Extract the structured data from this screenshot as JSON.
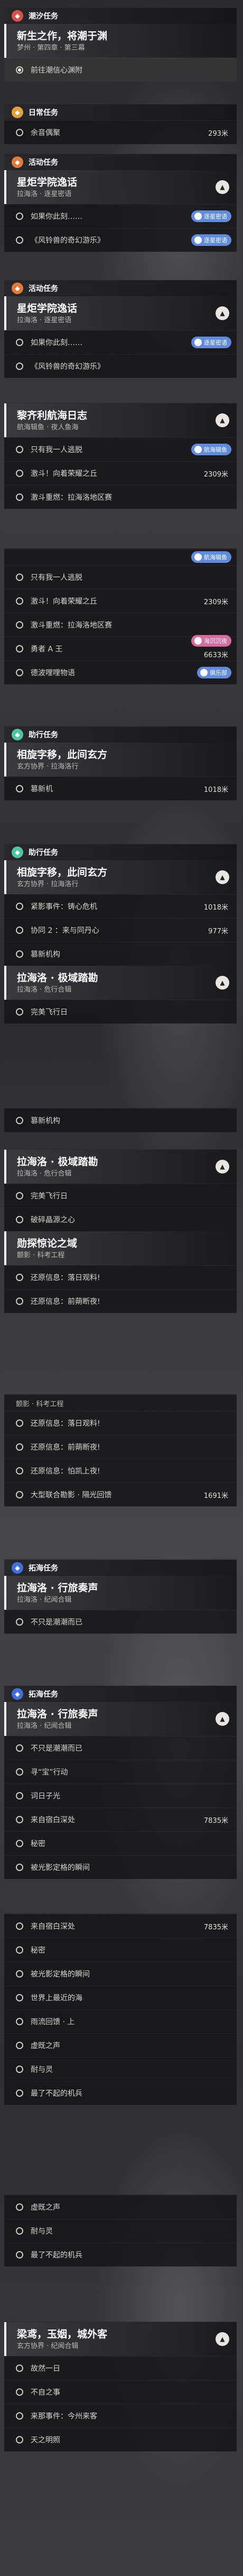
{
  "colors": {
    "main": "#d3534a",
    "daily": "#e2a03a",
    "event": "#e07a3a",
    "companion": "#4fc3a6",
    "ruins": "#3f6fd8",
    "tagBlue": "#5e8be0",
    "tagPink": "#d86ca0"
  },
  "categories": {
    "main": "潮汐任务",
    "daily": "日常任务",
    "event": "活动任务",
    "companion": "助行任务",
    "faction": "拓海任务"
  },
  "main_quest": {
    "title": "新生之作，将潮于渊",
    "sub": "梦州 · 第四章 · 第三幕",
    "step": "前往潮信心渊附"
  },
  "daily": {
    "steps": [
      {
        "text": "余音偶聚",
        "dist": "293米"
      }
    ]
  },
  "event1": {
    "title": "星炬学院逸话",
    "sub": "拉海洛 · 逐星密语",
    "tag": "逐星密语",
    "steps": [
      {
        "text": "如果你此刻……"
      },
      {
        "text": "《风铃兽的奇幻游乐》"
      }
    ]
  },
  "event2": {
    "title": "星炬学院逸话",
    "sub": "拉海洛 · 逐星密语",
    "tag": "逐星密语",
    "steps": [
      {
        "text": "如果你此刻……"
      },
      {
        "text": "《风铃兽的奇幻游乐》"
      }
    ]
  },
  "event3": {
    "title": "黎齐利航海日志",
    "sub": "航海辑鱼 · 夜人鱼海",
    "tag": "航海辑鱼",
    "steps": [
      {
        "text": "只有我一人逃脱"
      },
      {
        "text": "激斗！向着荣耀之丘",
        "dist": "2309米"
      },
      {
        "text": "激斗重燃：拉海洛地区赛"
      }
    ]
  },
  "event4": {
    "tag1": "航海辑鱼",
    "steps": [
      {
        "text": "只有我一人逃脱"
      },
      {
        "text": "激斗！向着荣耀之丘",
        "dist": "2309米"
      },
      {
        "text": "激斗重燃：拉海洛地区赛"
      },
      {
        "text": "勇者 A 王"
      }
    ],
    "tag2": "海沉沉夜",
    "dist2": "6633米",
    "tag3": "俱乐部",
    "step5": "德波哩哩物语"
  },
  "companion1": {
    "title": "相旋字移，此间玄方",
    "sub": "玄方协界 · 拉海洛行",
    "steps": [
      {
        "text": "篡新机",
        "dist": "1018米"
      }
    ]
  },
  "companion2": {
    "title": "相旋字移，此间玄方",
    "sub": "玄方协界 · 拉海洛行",
    "steps": [
      {
        "text": "紧影事件：铸心危机",
        "dist": "1018米"
      },
      {
        "text": "协同 2 ：来与同丹心",
        "dist": "977米"
      },
      {
        "text": "篡新机构"
      }
    ]
  },
  "quest_a": {
    "title": "拉海洛 · 极域踏勘",
    "sub": "拉海洛 · 危行合辑",
    "steps": [
      {
        "text": "完美飞行日"
      }
    ]
  },
  "quest_b": {
    "steps": [
      {
        "text": "篡新机构"
      }
    ]
  },
  "quest_c": {
    "title": "拉海洛 · 极域踏勘",
    "sub": "拉海洛 · 危行合辑",
    "steps": [
      {
        "text": "完美飞行日"
      },
      {
        "text": "破碎晶源之心"
      }
    ]
  },
  "quest_d": {
    "title": "勋探惊论之域",
    "sub": "颤影 · 科考工程",
    "steps": [
      {
        "text": "还原信息：落日观料!"
      },
      {
        "text": "还原信息：前蒴断夜!"
      }
    ]
  },
  "quest_e": {
    "header": "颤影 · 科考工程",
    "steps": [
      {
        "text": "还原信息：落日观料!"
      },
      {
        "text": "还原信息：前蒴断夜!"
      },
      {
        "text": "还原信息：怕凯上夜!"
      },
      {
        "text": "大型联合勘影 · 隔光回馈",
        "dist": "1691米"
      }
    ]
  },
  "faction1": {
    "title": "拉海洛 · 行旅奏声",
    "sub": "拉海洛 · 纪闻合辑",
    "steps": [
      {
        "text": "不只是潮潮而已"
      }
    ]
  },
  "faction2": {
    "title": "拉海洛 · 行旅奏声",
    "sub": "拉海洛 · 纪闻合辑",
    "steps": [
      {
        "text": "不只是潮潮而已"
      },
      {
        "text": "寻“宝”行动"
      },
      {
        "text": "词日子光"
      },
      {
        "text": "来自宿白深处",
        "dist": "7835米"
      },
      {
        "text": "秘密"
      },
      {
        "text": "被光影定格的瞬间"
      }
    ]
  },
  "faction3": {
    "steps": [
      {
        "text": "来自宿白深处",
        "dist": "7835米"
      },
      {
        "text": "秘密"
      },
      {
        "text": "被光影定格的瞬间"
      },
      {
        "text": "世界上最近的海"
      },
      {
        "text": "雨流回馈 · 上"
      },
      {
        "text": "虚既之声"
      },
      {
        "text": "耐与灵"
      },
      {
        "text": "最了不起的机兵"
      }
    ]
  },
  "faction4": {
    "steps": [
      {
        "text": "虚既之声"
      },
      {
        "text": "耐与灵"
      },
      {
        "text": "最了不起的机兵"
      }
    ]
  },
  "faction5": {
    "title": "梁鸢，玉姻，城外客",
    "sub": "玄方协界 · 纪闻合辑",
    "steps": [
      {
        "text": "故然一日"
      },
      {
        "text": "不自之事"
      },
      {
        "text": "来那事件：今州来客"
      },
      {
        "text": "天之明照"
      }
    ]
  }
}
